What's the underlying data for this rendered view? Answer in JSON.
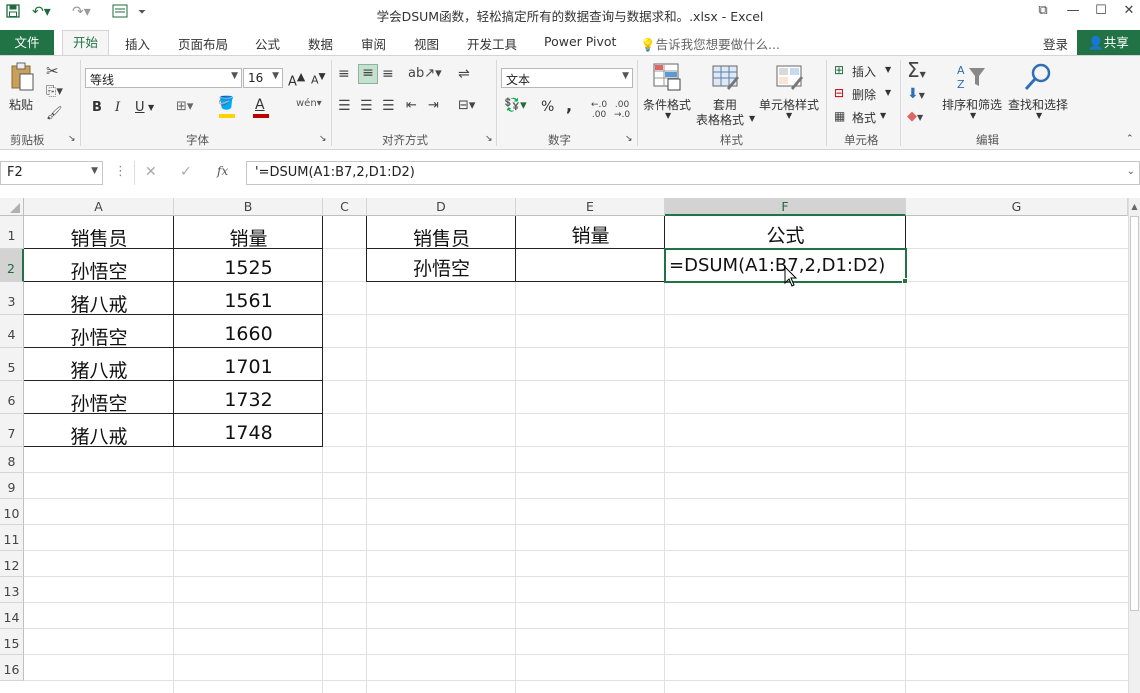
{
  "window": {
    "title": "学会DSUM函数，轻松搞定所有的数据查询与数据求和。.xlsx - Excel"
  },
  "tabs": [
    "文件",
    "开始",
    "插入",
    "页面布局",
    "公式",
    "数据",
    "审阅",
    "视图",
    "开发工具",
    "Power Pivot"
  ],
  "tell_me": "告诉我您想要做什么...",
  "login": "登录",
  "share": "共享",
  "ribbon": {
    "clipboard": {
      "paste": "粘贴",
      "label": "剪贴板"
    },
    "font": {
      "name": "等线",
      "size": "16",
      "label": "字体",
      "bold": "B",
      "italic": "I",
      "underline": "U"
    },
    "align": {
      "label": "对齐方式"
    },
    "number": {
      "format": "文本",
      "percent": "%",
      "comma": ",",
      "label": "数字"
    },
    "styles": {
      "cond": "条件格式",
      "table1": "套用",
      "table2": "表格格式",
      "cell": "单元格样式",
      "label": "样式"
    },
    "cells": {
      "insert": "插入",
      "delete": "删除",
      "format": "格式",
      "label": "单元格"
    },
    "edit": {
      "sort": "排序和筛选",
      "find": "查找和选择",
      "label": "编辑"
    }
  },
  "formula_bar": {
    "name_box": "F2",
    "fx": "fx",
    "formula": "'=DSUM(A1:B7,2,D1:D2)"
  },
  "columns": [
    "A",
    "B",
    "C",
    "D",
    "E",
    "F",
    "G"
  ],
  "rows": [
    "1",
    "2",
    "3",
    "4",
    "5",
    "6",
    "7",
    "8",
    "9",
    "10",
    "11",
    "12",
    "13",
    "14",
    "15",
    "16"
  ],
  "table": {
    "headers": [
      "销售员",
      "销量"
    ],
    "data": [
      [
        "孙悟空",
        "1525"
      ],
      [
        "猪八戒",
        "1561"
      ],
      [
        "孙悟空",
        "1660"
      ],
      [
        "猪八戒",
        "1701"
      ],
      [
        "孙悟空",
        "1732"
      ],
      [
        "猪八戒",
        "1748"
      ]
    ]
  },
  "criteria": {
    "headers": [
      "销售员",
      "销量",
      "公式"
    ],
    "values": [
      "孙悟空",
      "",
      "=DSUM(A1:B7,2,D1:D2)"
    ]
  }
}
